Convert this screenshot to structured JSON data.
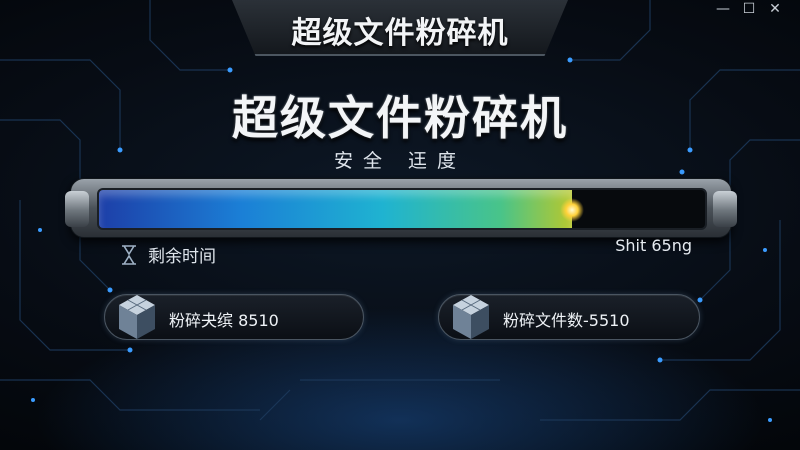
{
  "window": {
    "title": "超级文件粉碎机",
    "controls": {
      "minimize": "—",
      "maximize": "☐",
      "close": "✕"
    }
  },
  "main": {
    "heading": "超级文件粉碎机",
    "subtitle": "安全 迋度"
  },
  "progress": {
    "fill_fraction": 0.78,
    "remaining_label": "剩余时间",
    "speed_text": "Shit 65ng",
    "remaining_icon": "hourglass-icon"
  },
  "stats": [
    {
      "label": "粉碎夬缤 8510",
      "icon": "cube-icon"
    },
    {
      "label": "粉碎文件数-5510",
      "icon": "cube-icon"
    }
  ],
  "colors": {
    "accent_blue": "#1b7fd6",
    "accent_green": "#49c489",
    "accent_yellow": "#ffd23a",
    "background": "#070c14"
  }
}
